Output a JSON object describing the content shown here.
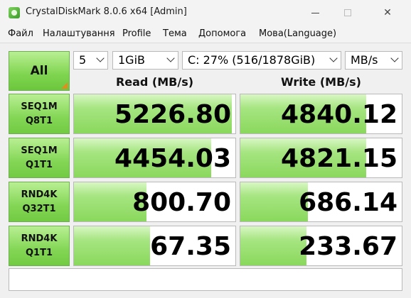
{
  "window": {
    "title": "CrystalDiskMark 8.0.6 x64 [Admin]"
  },
  "menu": [
    "Файл",
    "Налаштування",
    "Profile",
    "Тема",
    "Допомога",
    "Мова(Language)"
  ],
  "controls": {
    "all_label": "All",
    "count": "5",
    "size": "1GiB",
    "drive": "C: 27% (516/1878GiB)",
    "unit": "MB/s"
  },
  "headers": {
    "read": "Read (MB/s)",
    "write": "Write (MB/s)"
  },
  "tests": [
    {
      "line1": "SEQ1M",
      "line2": "Q8T1",
      "read": "5226.80",
      "write": "4840.12",
      "read_level": 0.98,
      "write_level": 0.78
    },
    {
      "line1": "SEQ1M",
      "line2": "Q1T1",
      "read": "4454.03",
      "write": "4821.15",
      "read_level": 0.85,
      "write_level": 0.78
    },
    {
      "line1": "RND4K",
      "line2": "Q32T1",
      "read": "800.70",
      "write": "686.14",
      "read_level": 0.45,
      "write_level": 0.42
    },
    {
      "line1": "RND4K",
      "line2": "Q1T1",
      "read": "67.35",
      "write": "233.67",
      "read_level": 0.47,
      "write_level": 0.41
    }
  ],
  "comment": ""
}
